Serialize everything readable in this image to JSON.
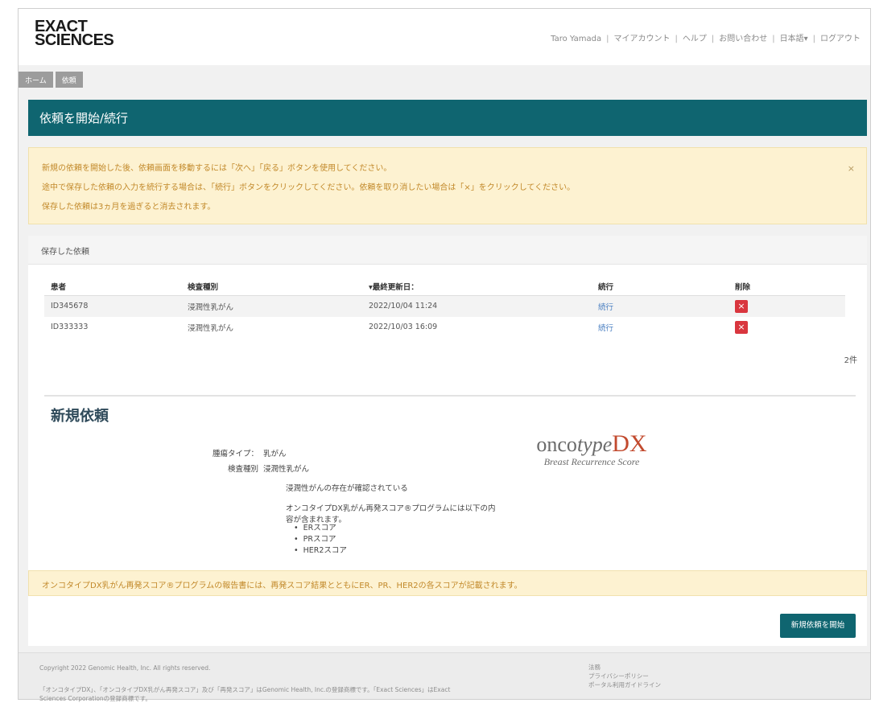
{
  "header": {
    "logo_line1": "EXACT",
    "logo_line2": "SCIENCES",
    "nav": [
      "Taro Yamada",
      "マイアカウント",
      "ヘルプ",
      "お問い合わせ",
      "日本語▾",
      "ログアウト"
    ]
  },
  "breadcrumbs": [
    "ホーム",
    "依頼"
  ],
  "page_title": "依頼を開始/続行",
  "notice": {
    "lines": [
      "新規の依頼を開始した後、依頼画面を移動するには「次へ」「戻る」ボタンを使用してください。",
      "途中で保存した依頼の入力を続行する場合は、「続行」ボタンをクリックしてください。依頼を取り消したい場合は「×」をクリックしてください。",
      "保存した依頼は3ヵ月を過ぎると消去されます。"
    ],
    "close": "×"
  },
  "saved": {
    "heading": "保存した依頼",
    "columns": [
      "患者",
      "検査種別",
      "▾最終更新日：",
      "続行",
      "削除"
    ],
    "rows": [
      {
        "patient": "ID345678",
        "type": "浸潤性乳がん",
        "updated": "2022/10/04 11:24",
        "resume": "続行"
      },
      {
        "patient": "ID333333",
        "type": "浸潤性乳がん",
        "updated": "2022/10/03 16:09",
        "resume": "続行"
      }
    ],
    "count": "2件"
  },
  "new_request": {
    "title": "新規依頼",
    "tumor_type_label": "腫瘍タイプ：",
    "tumor_type_value": "乳がん",
    "test_type_label": "検査種別",
    "test_type_value": "浸潤性乳がん",
    "confirm_text": "浸潤性がんの存在が確認されている",
    "program_text_1": "オンコタイプDX乳がん再発スコア®プログラムには以下の内",
    "program_text_2": "容が含まれます。",
    "bullets": [
      "ERスコア",
      "PRスコア",
      "HER2スコア"
    ],
    "logo_main_a": "onco",
    "logo_main_b": "type",
    "logo_dx": "DX",
    "logo_sub": "Breast Recurrence Score",
    "note": "オンコタイプDX乳がん再発スコア®プログラムの報告書には、再発スコア結果とともにER、PR、HER2の各スコアが記載されます。",
    "start_button": "新規依頼を開始"
  },
  "footer": {
    "copyright": "Copyright 2022 Genomic Health, Inc. All rights reserved.",
    "trademark_1": "「オンコタイプDX」、「オンコタイプDX乳がん再発スコア」及び「再発スコア」はGenomic Health, Inc.の登録商標です。「Exact Sciences」はExact",
    "trademark_2": "Sciences Corporationの登録商標です。",
    "links": [
      "法務",
      "プライバシーポリシー",
      "ポータル利用ガイドライン"
    ]
  }
}
